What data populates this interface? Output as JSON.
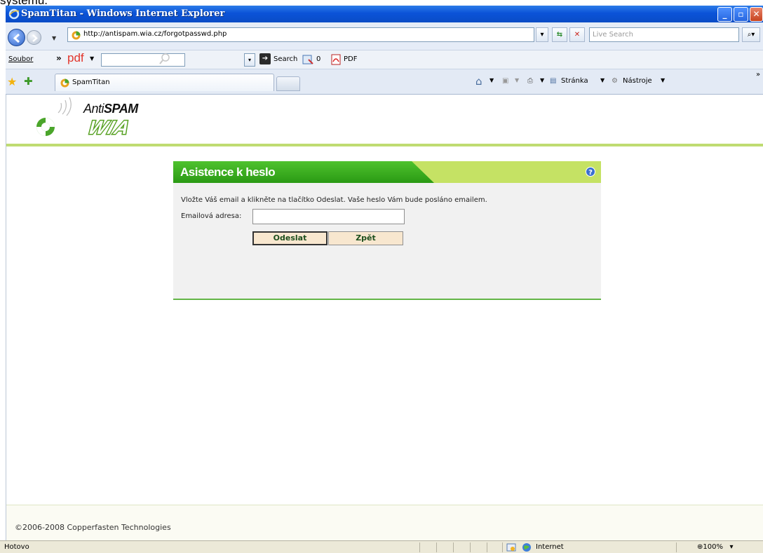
{
  "doc_fragment": "systemu.",
  "window": {
    "title": "SpamTitan - Windows Internet Explorer",
    "minimize": "_",
    "maximize": "▫",
    "close": "✕"
  },
  "addressbar": {
    "url": "http://antispam.wia.cz/forgotpasswd.php",
    "live_search_placeholder": "Live Search"
  },
  "toolbar": {
    "menu_soubor": "Soubor",
    "chevron": "»",
    "pdf_logo": "pdf",
    "search_label": "Search",
    "count": "0",
    "pdf_label": "PDF"
  },
  "tabs": {
    "active_label": "SpamTitan",
    "stranka": "Stránka",
    "nastroje": "Nástroje"
  },
  "page": {
    "logo_anti": "Anti",
    "logo_spam": "SPAM",
    "logo_wia": "WIA",
    "panel_title": "Asistence k heslo",
    "instructions": "Vložte Váš email a klikněte na tlačítko Odeslat. Vaše heslo Vám bude posláno emailem.",
    "email_label": "Emailová adresa:",
    "email_value": "",
    "send_button": "Odeslat",
    "back_button": "Zpět",
    "copyright": "©2006-2008 Copperfasten Technologies"
  },
  "statusbar": {
    "status": "Hotovo",
    "zone": "Internet",
    "zoom": "100%"
  },
  "colors": {
    "title_bar": "#0b53d8",
    "panel_green": "#3fae22",
    "panel_lime": "#c5e264",
    "button_bg": "#f8e7cf"
  }
}
